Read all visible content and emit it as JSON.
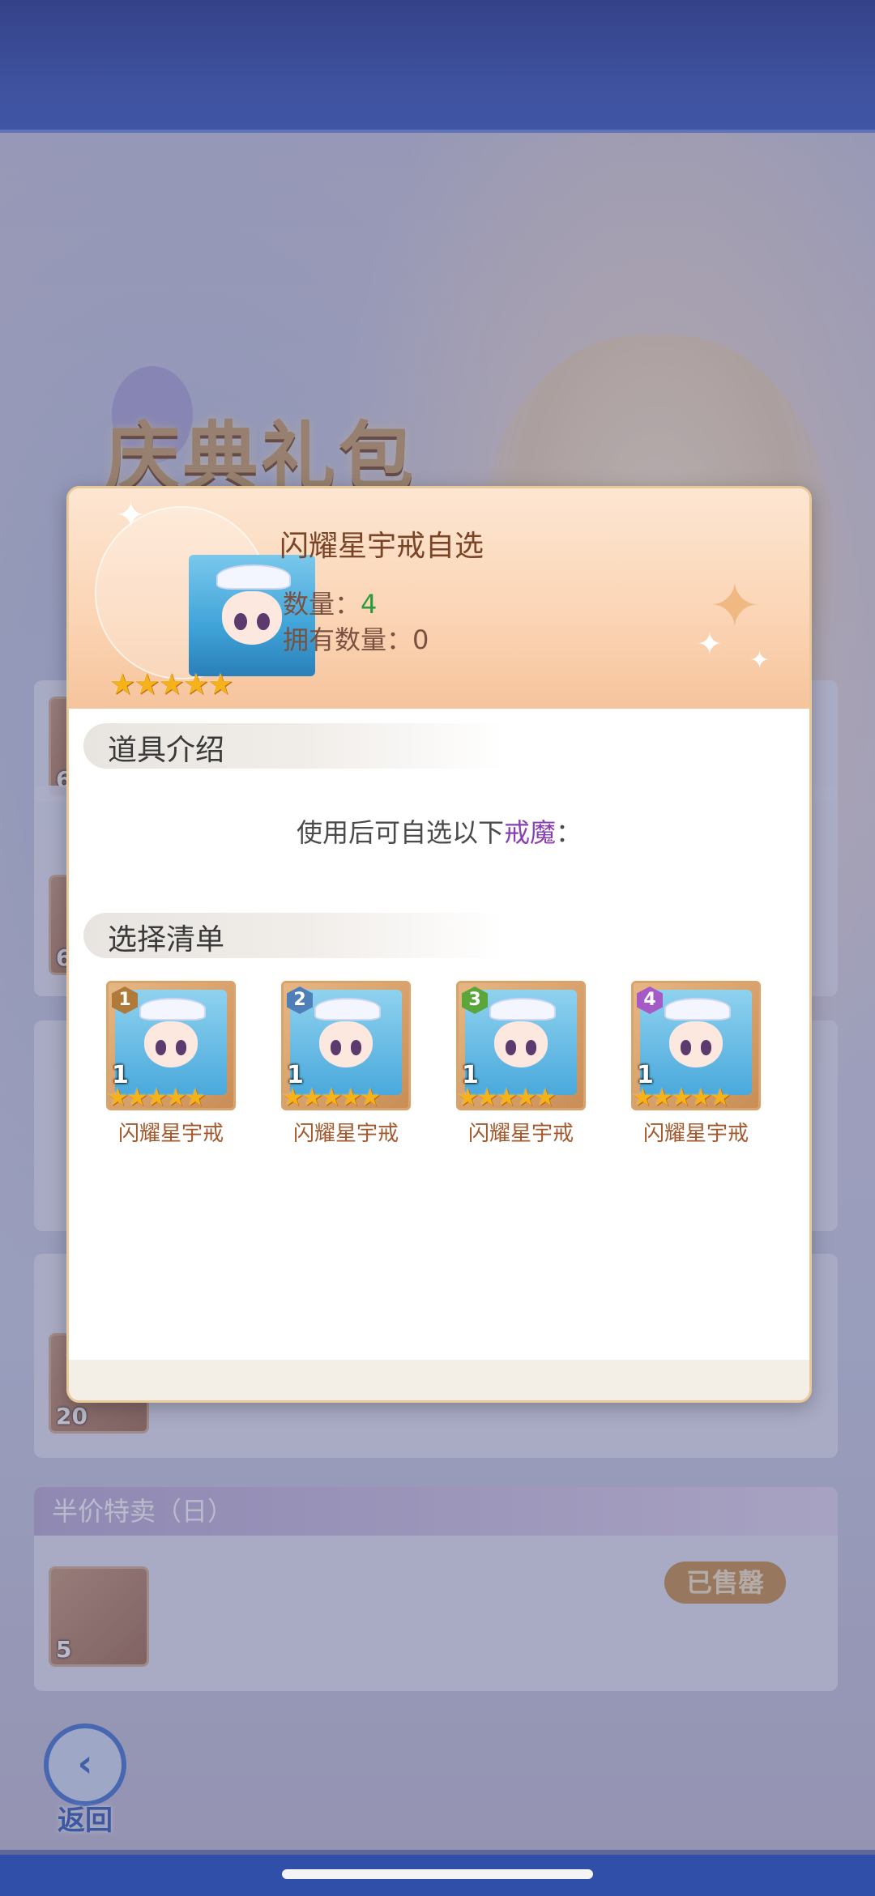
{
  "background": {
    "banner_title": "庆典礼包",
    "cards": [
      {
        "header": "",
        "item_count": "6"
      },
      {
        "header": "",
        "item_count": "6"
      },
      {
        "header": "",
        "item_count": "20"
      },
      {
        "header": "半价特卖（日）",
        "item_count": "5",
        "button": "已售罄"
      }
    ],
    "back_label": "返回"
  },
  "modal": {
    "item_title": "闪耀星宇戒自选",
    "quantity_label": "数量：",
    "quantity_value": "4",
    "owned_label": "拥有数量：",
    "owned_value": "0",
    "item_stars": 5,
    "section_intro": "道具介绍",
    "description_prefix": "使用后可自选以下",
    "description_highlight": "戒魔",
    "description_suffix": "：",
    "section_list": "选择清单",
    "choices": [
      {
        "badge": "1",
        "badge_color": "#b07a3a",
        "count": "1",
        "stars": 5,
        "name": "闪耀星宇戒"
      },
      {
        "badge": "2",
        "badge_color": "#4f7fb8",
        "count": "1",
        "stars": 5,
        "name": "闪耀星宇戒"
      },
      {
        "badge": "3",
        "badge_color": "#5aa63a",
        "count": "1",
        "stars": 5,
        "name": "闪耀星宇戒"
      },
      {
        "badge": "4",
        "badge_color": "#a65ac8",
        "count": "1",
        "stars": 5,
        "name": "闪耀星宇戒"
      }
    ]
  },
  "colors": {
    "accent_text": "#7a4426",
    "quantity_green": "#2e9a3e",
    "highlight_purple": "#8a3fb0",
    "star_gold": "#f6b21a"
  }
}
